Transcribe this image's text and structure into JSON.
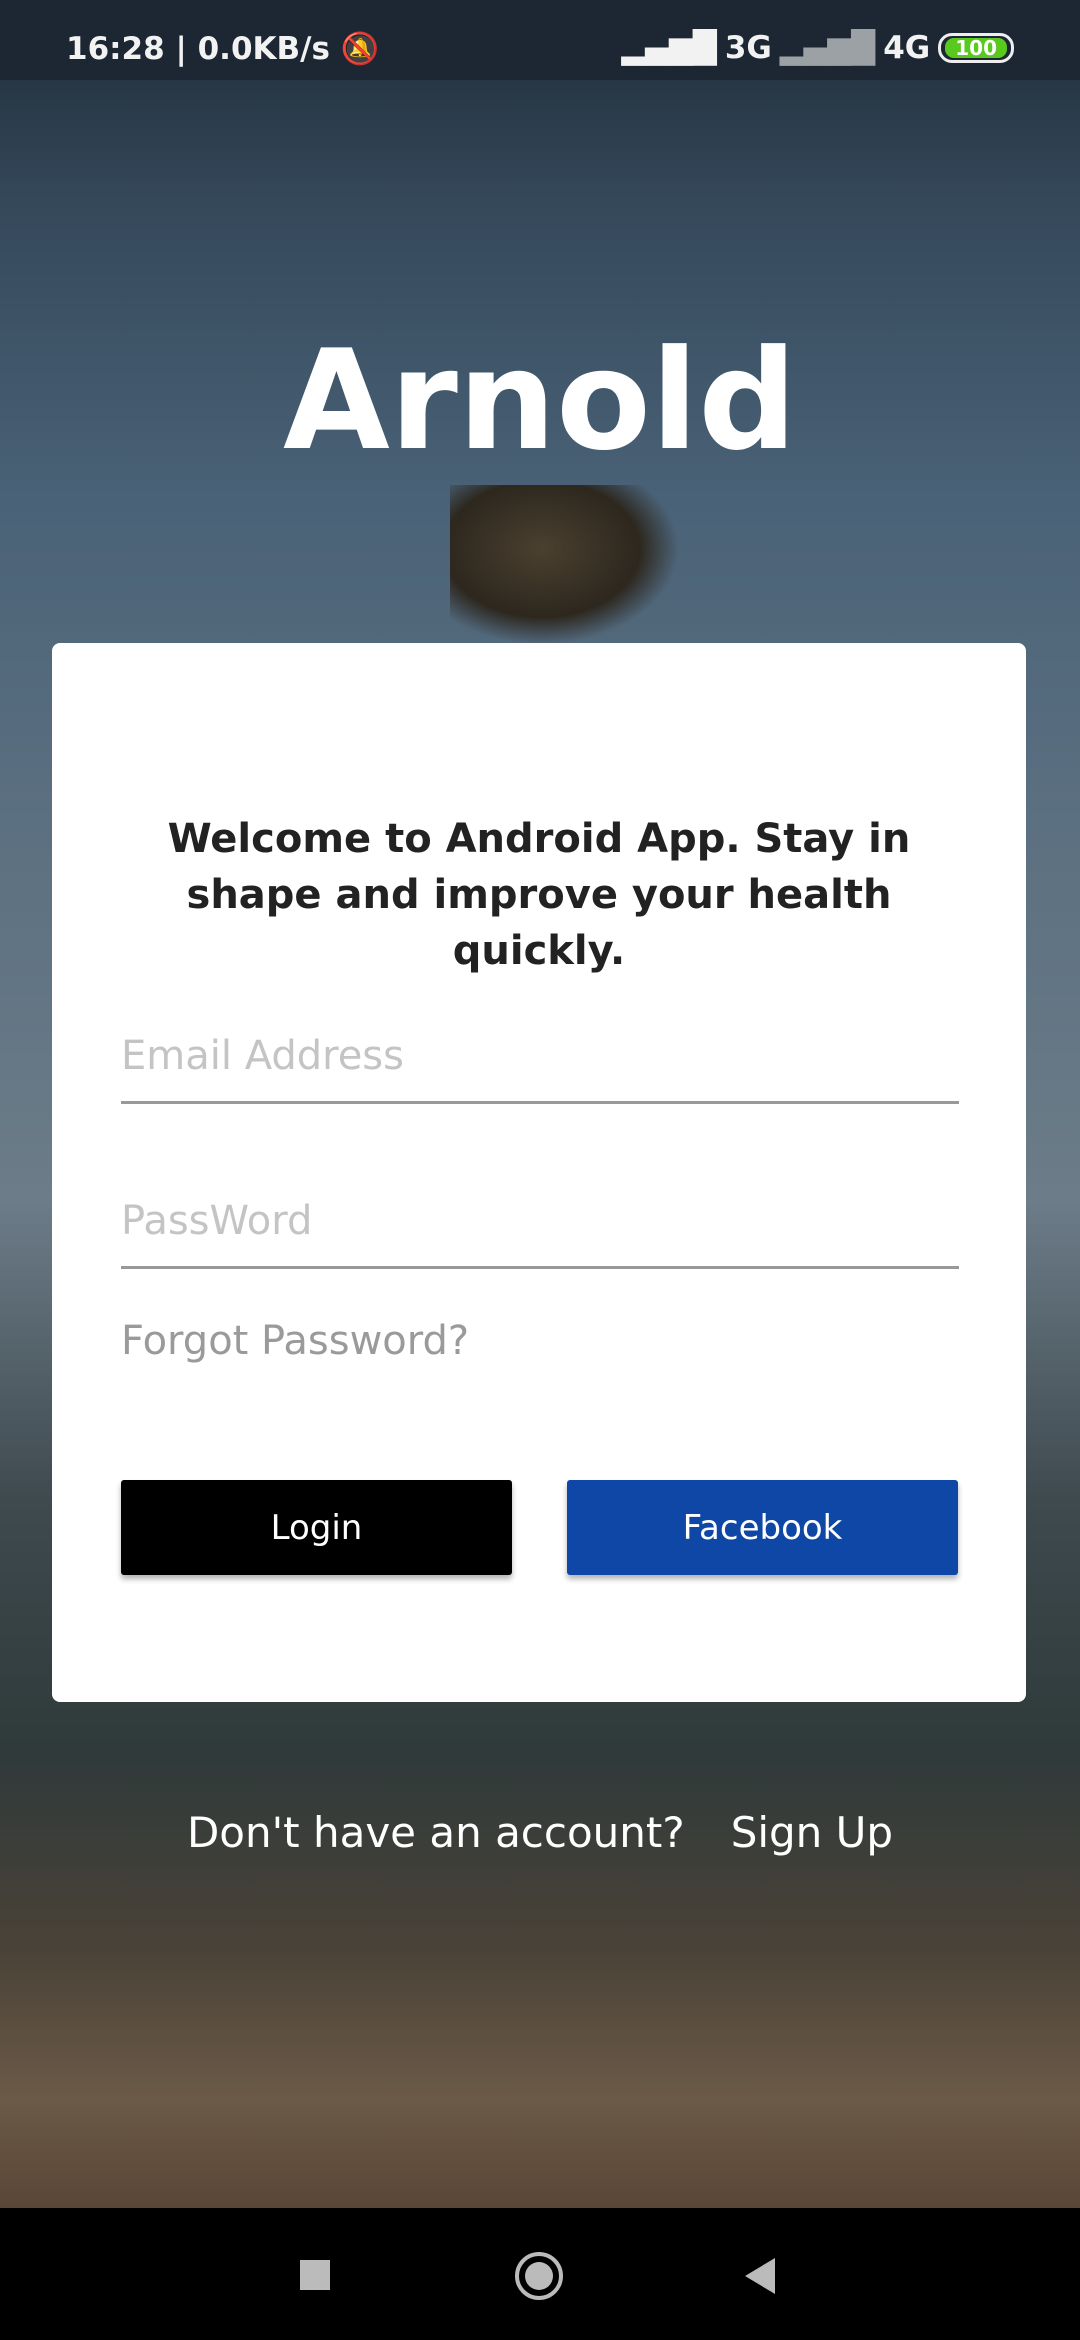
{
  "status_bar": {
    "time": "16:28",
    "speed": "0.0KB/s",
    "net1": "3G",
    "net2": "4G",
    "battery": "100"
  },
  "app_title": "Arnold",
  "card": {
    "welcome": "Welcome to Android App. Stay in shape and improve your health quickly.",
    "email_placeholder": "Email Address",
    "password_placeholder": "PassWord",
    "forgot": "Forgot Password?",
    "login": "Login",
    "facebook": "Facebook"
  },
  "signup": {
    "prompt": "Don't have an account?",
    "link": "Sign Up"
  },
  "colors": {
    "facebook": "#0f47a6",
    "login": "#000000"
  }
}
